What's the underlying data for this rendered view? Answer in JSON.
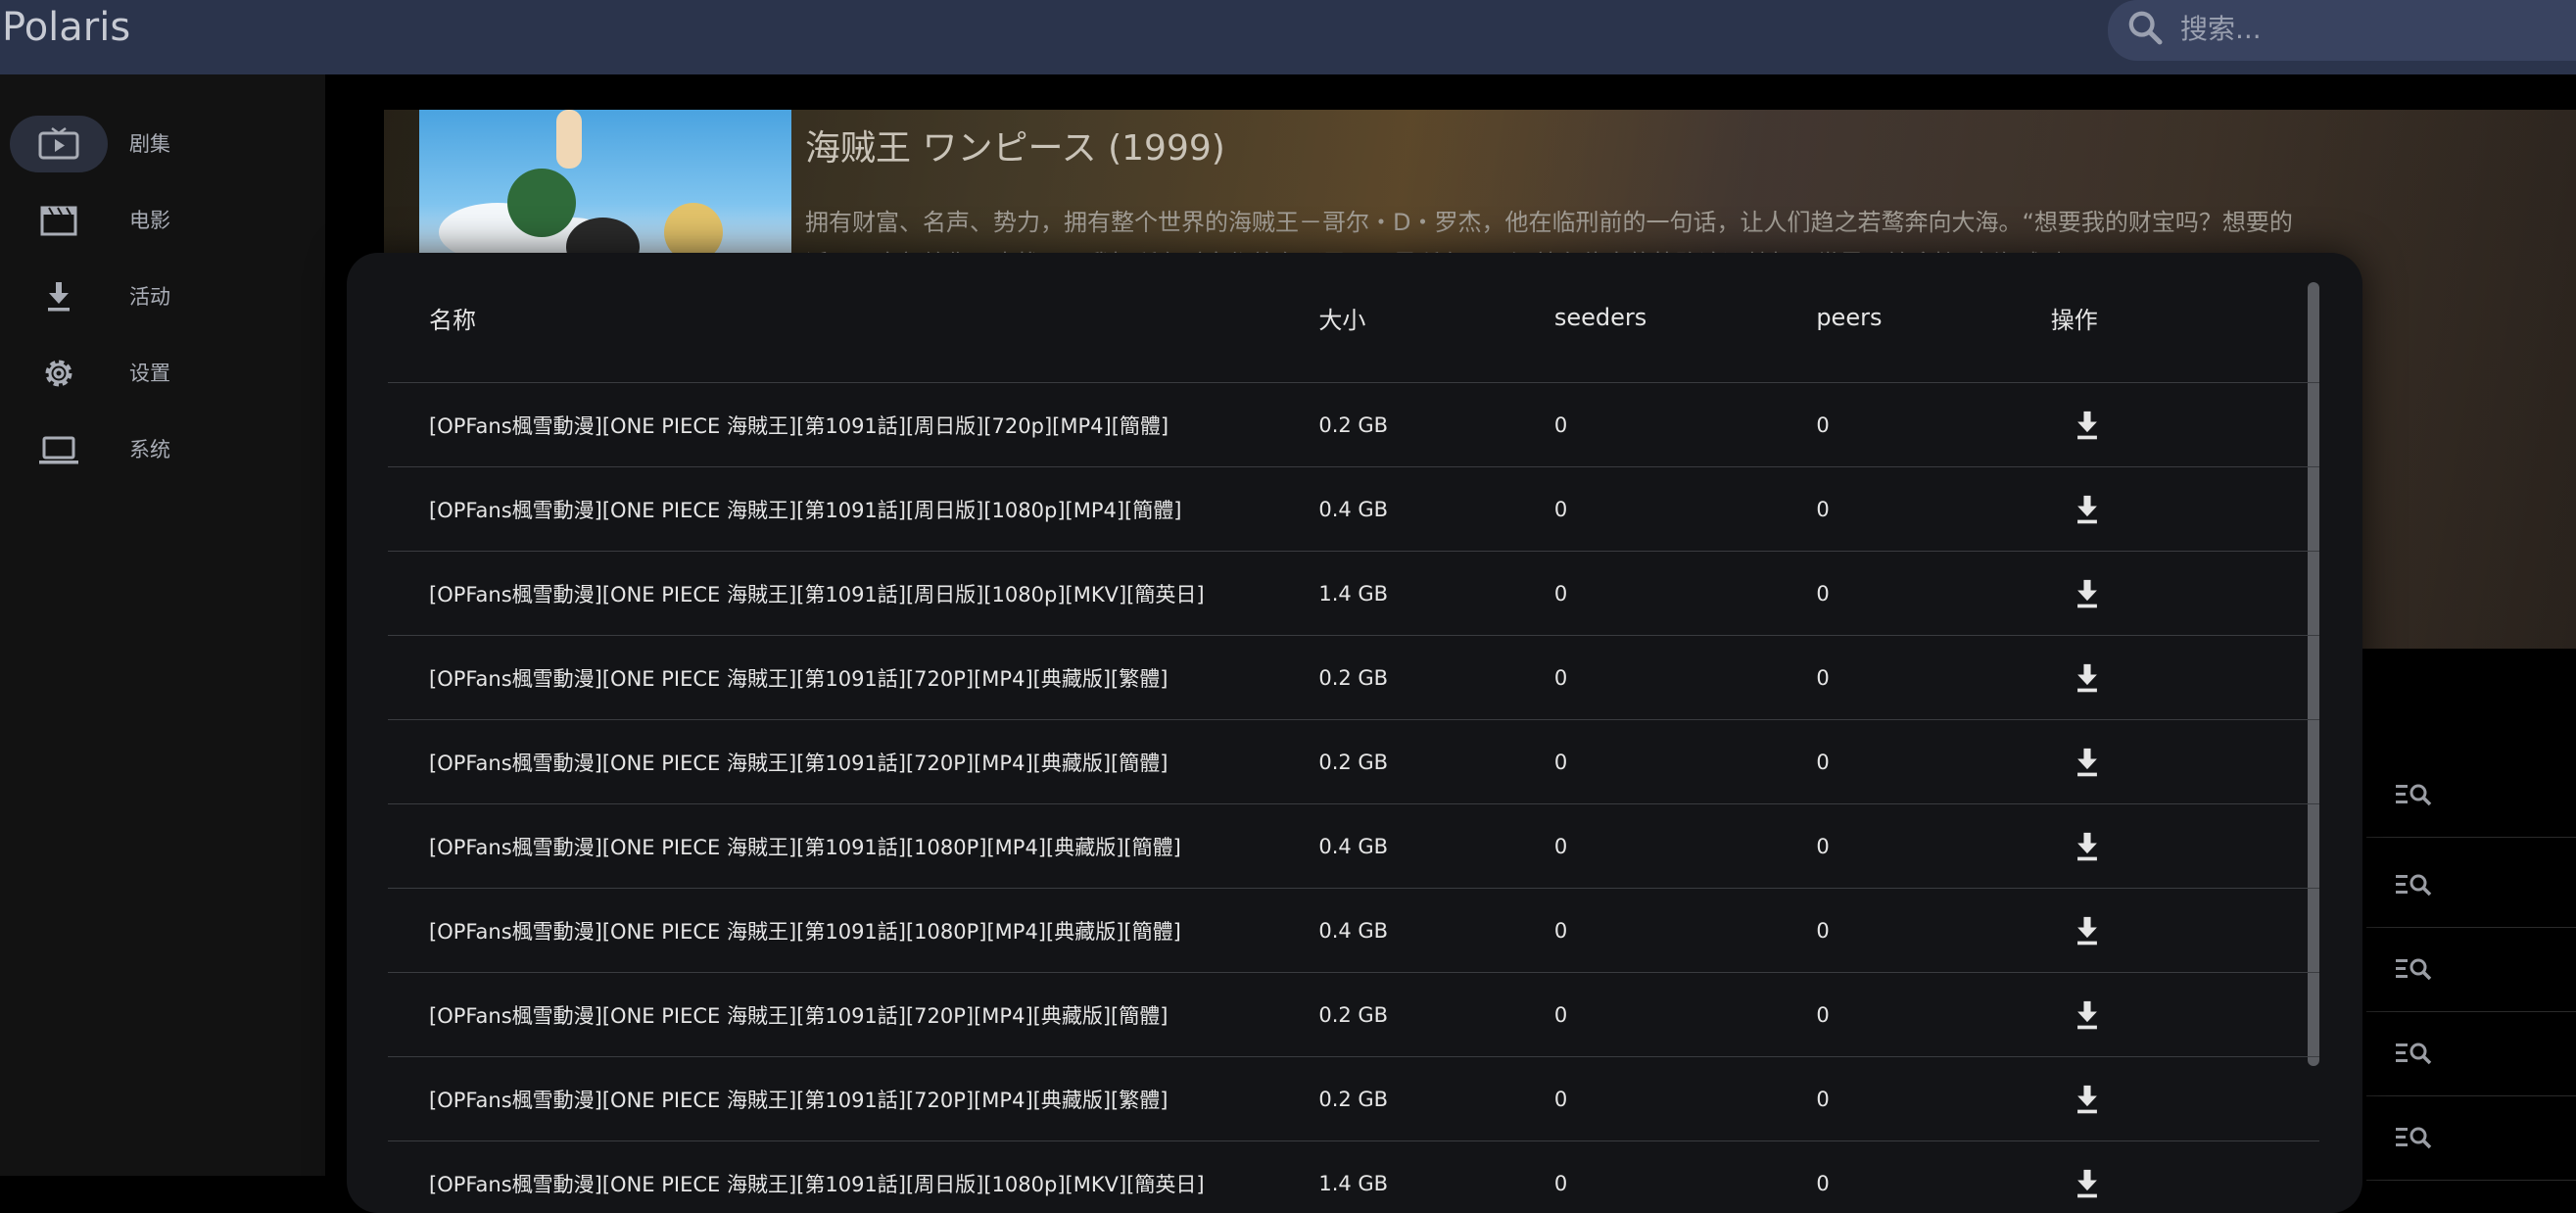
{
  "app": {
    "title": "Polaris"
  },
  "search": {
    "placeholder": "搜索..."
  },
  "sidebar": {
    "items": [
      {
        "label": "剧集",
        "icon": "tv-icon",
        "active": true
      },
      {
        "label": "电影",
        "icon": "movie-clapper-icon",
        "active": false
      },
      {
        "label": "活动",
        "icon": "download-icon",
        "active": false
      },
      {
        "label": "设置",
        "icon": "gear-icon",
        "active": false
      },
      {
        "label": "系统",
        "icon": "laptop-icon",
        "active": false
      }
    ]
  },
  "show": {
    "title": "海贼王 ワンピース (1999)",
    "description": "拥有财富、名声、势力，拥有整个世界的海贼王－哥尔・D・罗杰，他在临刑前的一句话，让人们趋之若鹜奔向大海。“想要我的财宝吗？想要的话可以全部给你，去找吧！我把所有财宝都放在那里。”于是所有男子汉就在伟大的航路追逐梦想，世界开始迎接“大海贼时"
  },
  "dialog": {
    "columns": {
      "name": "名称",
      "size": "大小",
      "seeders": "seeders",
      "peers": "peers",
      "action": "操作"
    },
    "rows": [
      {
        "name": "[OPFans楓雪動漫][ONE PIECE 海賊王][第1091話][周日版][720p][MP4][簡體]",
        "size": "0.2 GB",
        "seeders": "0",
        "peers": "0"
      },
      {
        "name": "[OPFans楓雪動漫][ONE PIECE 海賊王][第1091話][周日版][1080p][MP4][簡體]",
        "size": "0.4 GB",
        "seeders": "0",
        "peers": "0"
      },
      {
        "name": "[OPFans楓雪動漫][ONE PIECE 海賊王][第1091話][周日版][1080p][MKV][簡英日]",
        "size": "1.4 GB",
        "seeders": "0",
        "peers": "0"
      },
      {
        "name": "[OPFans楓雪動漫][ONE PIECE 海賊王][第1091話][720P][MP4][典藏版][繁體]",
        "size": "0.2 GB",
        "seeders": "0",
        "peers": "0"
      },
      {
        "name": "[OPFans楓雪動漫][ONE PIECE 海賊王][第1091話][720P][MP4][典藏版][簡體]",
        "size": "0.2 GB",
        "seeders": "0",
        "peers": "0"
      },
      {
        "name": "[OPFans楓雪動漫][ONE PIECE 海賊王][第1091話][1080P][MP4][典藏版][簡體]",
        "size": "0.4 GB",
        "seeders": "0",
        "peers": "0"
      },
      {
        "name": "[OPFans楓雪動漫][ONE PIECE 海賊王][第1091話][1080P][MP4][典藏版][簡體]",
        "size": "0.4 GB",
        "seeders": "0",
        "peers": "0"
      },
      {
        "name": "[OPFans楓雪動漫][ONE PIECE 海賊王][第1091話][720P][MP4][典藏版][簡體]",
        "size": "0.2 GB",
        "seeders": "0",
        "peers": "0"
      },
      {
        "name": "[OPFans楓雪動漫][ONE PIECE 海賊王][第1091話][720P][MP4][典藏版][繁體]",
        "size": "0.2 GB",
        "seeders": "0",
        "peers": "0"
      },
      {
        "name": "[OPFans楓雪動漫][ONE PIECE 海賊王][第1091話][周日版][1080p][MKV][簡英日]",
        "size": "1.4 GB",
        "seeders": "0",
        "peers": "0"
      }
    ]
  },
  "colors": {
    "appbar": "#2b344c",
    "sidebar": "#121212",
    "dialog": "#131417",
    "accent_text": "#e6e6e6"
  }
}
